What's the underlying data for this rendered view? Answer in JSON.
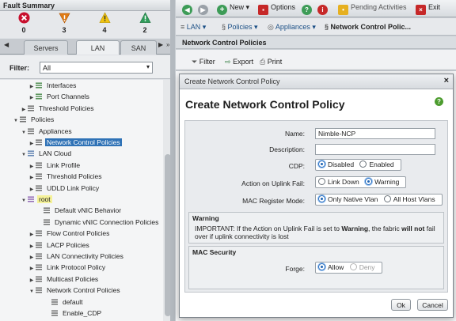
{
  "fault_summary": {
    "title": "Fault Summary",
    "counts": [
      {
        "icon": "critical-x-icon",
        "value": "0",
        "color": "#c8102e"
      },
      {
        "icon": "major-warning-icon",
        "value": "3",
        "color": "#e07b14"
      },
      {
        "icon": "minor-warning-icon",
        "value": "4",
        "color": "#f1c40f"
      },
      {
        "icon": "warning-triangle-icon",
        "value": "2",
        "color": "#2f9d5a"
      }
    ]
  },
  "nav_tabs": [
    "Servers",
    "LAN",
    "SAN"
  ],
  "active_tab": "LAN",
  "filter": {
    "label": "Filter:",
    "value": "All"
  },
  "tree": [
    {
      "label": "Interfaces"
    },
    {
      "label": "Port Channels"
    },
    {
      "label": "Threshold Policies"
    },
    {
      "label": "Policies"
    },
    {
      "label": "Appliances"
    },
    {
      "label": "Network Control Policies"
    },
    {
      "label": "LAN Cloud"
    },
    {
      "label": "Link Profile"
    },
    {
      "label": "Threshold Policies"
    },
    {
      "label": "UDLD Link Policy"
    },
    {
      "label": "root"
    },
    {
      "label": "Default vNIC Behavior"
    },
    {
      "label": "Dynamic vNIC Connection Policies"
    },
    {
      "label": "Flow Control Policies"
    },
    {
      "label": "LACP Policies"
    },
    {
      "label": "LAN Connectivity Policies"
    },
    {
      "label": "Link Protocol Policy"
    },
    {
      "label": "Multicast Policies"
    },
    {
      "label": "Network Control Policies"
    },
    {
      "label": "default"
    },
    {
      "label": "Enable_CDP"
    }
  ],
  "toolbar": {
    "new": "New",
    "options": "Options",
    "pending": "Pending Activities",
    "exit": "Exit"
  },
  "breadcrumbs": [
    "LAN",
    "Policies",
    "Appliances",
    "Network Control Polic..."
  ],
  "content": {
    "title": "Network Control Policies",
    "filter": "Filter",
    "export": "Export",
    "print": "Print"
  },
  "dialog": {
    "window_title": "Create Network Control Policy",
    "heading": "Create Network Control Policy",
    "close": "×",
    "help": "?",
    "name_label": "Name:",
    "name_value": "Nimble-NCP",
    "description_label": "Description:",
    "description_value": "",
    "cdp_label": "CDP:",
    "cdp_options": [
      "Disabled",
      "Enabled"
    ],
    "uplink_label": "Action on Uplink Fail:",
    "uplink_options": [
      "Link Down",
      "Warning"
    ],
    "mac_label": "MAC Register Mode:",
    "mac_options": [
      "Only Native Vlan",
      "All Host Vlans"
    ],
    "warning_title": "Warning",
    "warning_text_a": "IMPORTANT: If the Action on Uplink Fail is set to ",
    "warning_text_b": "Warning",
    "warning_text_c": ", the fabric ",
    "warning_text_d": "will not",
    "warning_text_e": " fail over if uplink connectivity is lost",
    "mac_security_title": "MAC Security",
    "forge_label": "Forge:",
    "forge_options": [
      "Allow",
      "Deny"
    ],
    "ok": "Ok",
    "cancel": "Cancel"
  }
}
